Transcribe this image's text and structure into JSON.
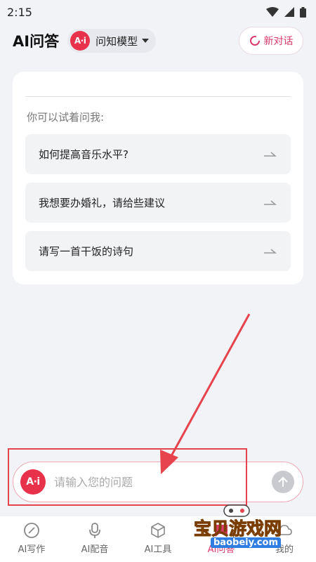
{
  "status_bar": {
    "time": "2:15"
  },
  "header": {
    "title": "AI问答",
    "model_selector": {
      "logo_text": "A·i",
      "label": "问知模型",
      "icon": "caret-down-icon"
    },
    "new_chat_label": "新对话"
  },
  "suggestions_card": {
    "hint": "你可以试着问我:",
    "items": [
      {
        "text": "如何提高音乐水平?"
      },
      {
        "text": "我想要办婚礼，请给些建议"
      },
      {
        "text": "请写一首干饭的诗句"
      }
    ]
  },
  "input_bar": {
    "placeholder": "请输入您的问题",
    "value": ""
  },
  "tab_bar": {
    "tabs": [
      {
        "label": "AI写作",
        "icon": "pencil-icon"
      },
      {
        "label": "AI配音",
        "icon": "microphone-icon"
      },
      {
        "label": "AI工具",
        "icon": "cube-icon"
      },
      {
        "label": "AI问答",
        "icon": "chat-icon",
        "active": true
      },
      {
        "label": "我的",
        "icon": "cloud-icon"
      }
    ]
  },
  "watermark": {
    "main": "宝贝游戏网",
    "url": "baobeiy.com"
  },
  "colors": {
    "accent": "#d93a6a",
    "brand_logo": "#e8314a",
    "annotation": "#e6434d"
  }
}
